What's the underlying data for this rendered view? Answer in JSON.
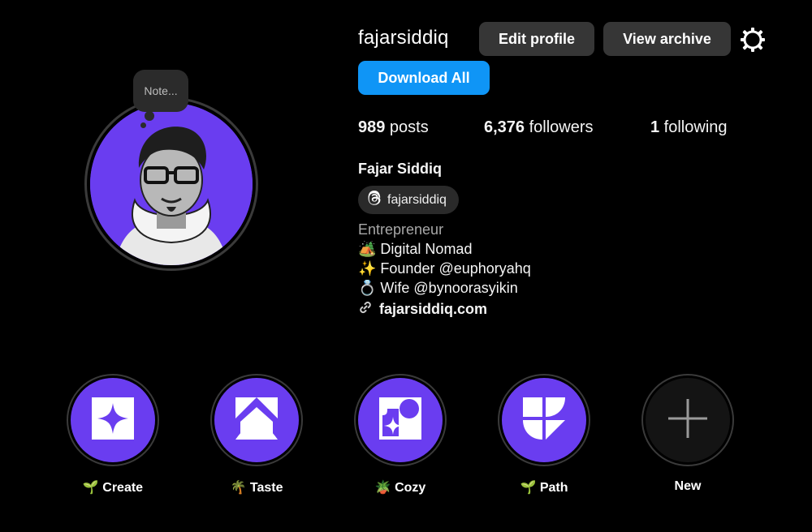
{
  "profile": {
    "username": "fajarsiddiq",
    "edit_label": "Edit profile",
    "archive_label": "View archive",
    "download_label": "Download All",
    "note_label": "Note...",
    "stats": {
      "posts_count": "989",
      "posts_label": " posts",
      "followers_count": "6,376",
      "followers_label": " followers",
      "following_count": "1",
      "following_label": " following"
    },
    "full_name": "Fajar Siddiq",
    "threads_handle": "fajarsiddiq",
    "category": "Entrepreneur",
    "bio": [
      "🏕️ Digital Nomad",
      "✨ Founder @euphoryahq",
      "💍 Wife @bynoorasyikin"
    ],
    "link": "fajarsiddiq.com"
  },
  "highlights": [
    {
      "label": "🌱 Create",
      "icon": "sparkle-square-icon"
    },
    {
      "label": "🌴 Taste",
      "icon": "arch-shape-icon"
    },
    {
      "label": "🪴 Cozy",
      "icon": "cozy-shapes-icon"
    },
    {
      "label": "🌱 Path",
      "icon": "path-shapes-icon"
    },
    {
      "label": "New",
      "icon": "plus-icon"
    }
  ],
  "colors": {
    "background": "#000000",
    "accent_blue": "#0f95f6",
    "button_gray": "#363636",
    "highlight_purple": "#6a3df0"
  }
}
